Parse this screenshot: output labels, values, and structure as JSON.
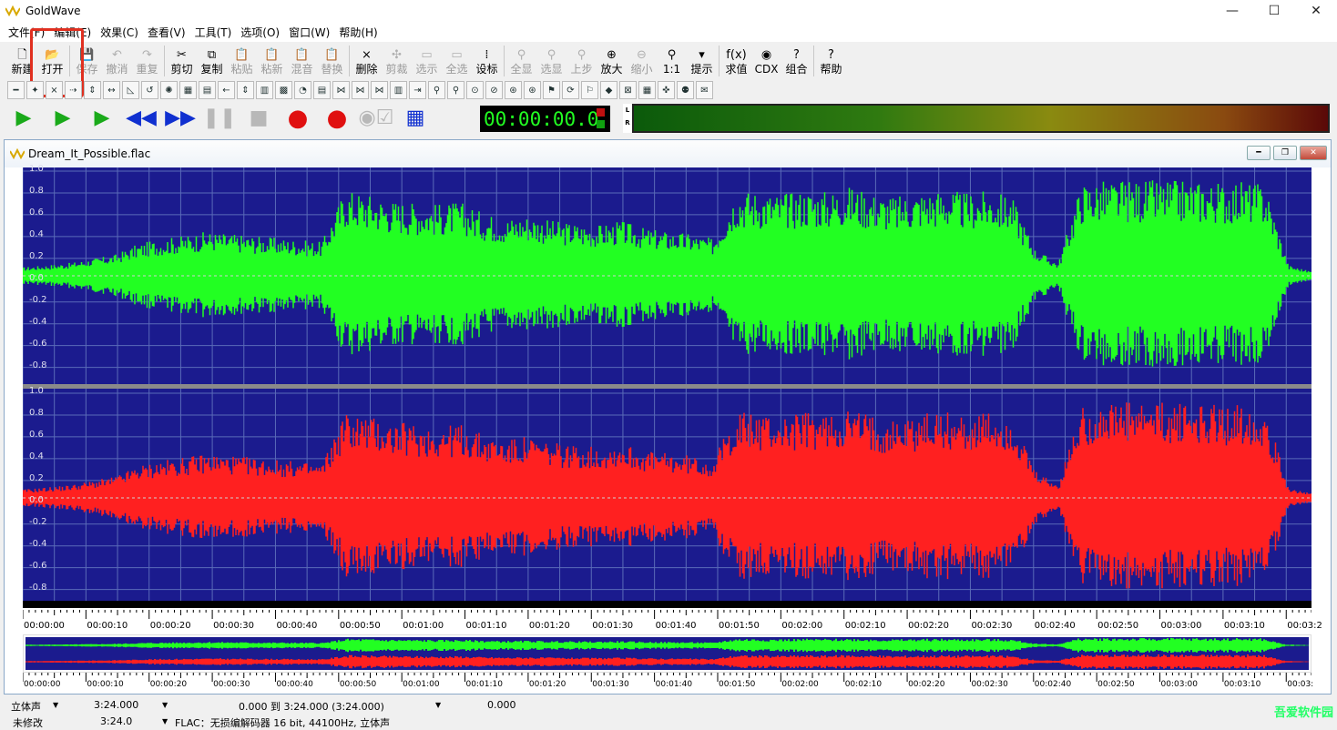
{
  "app": {
    "title": "GoldWave",
    "logo_icon": "goldwave-logo-icon"
  },
  "window_controls": {
    "minimize": "—",
    "maximize": "☐",
    "close": "✕"
  },
  "menu": [
    "文件(F)",
    "编辑(E)",
    "效果(C)",
    "查看(V)",
    "工具(T)",
    "选项(O)",
    "窗口(W)",
    "帮助(H)"
  ],
  "toolbar": [
    {
      "label": "新建",
      "icon": "new-file-icon",
      "glyph": "🗋",
      "enabled": true
    },
    {
      "label": "打开",
      "icon": "open-folder-icon",
      "glyph": "📂",
      "enabled": true
    },
    {
      "label": "保存",
      "icon": "save-icon",
      "glyph": "💾",
      "enabled": false
    },
    {
      "label": "撤消",
      "icon": "undo-icon",
      "glyph": "↶",
      "enabled": false
    },
    {
      "label": "重复",
      "icon": "redo-icon",
      "glyph": "↷",
      "enabled": false
    },
    {
      "label": "剪切",
      "icon": "cut-icon",
      "glyph": "✂",
      "enabled": true
    },
    {
      "label": "复制",
      "icon": "copy-icon",
      "glyph": "⧉",
      "enabled": true
    },
    {
      "label": "粘贴",
      "icon": "paste-icon",
      "glyph": "📋",
      "enabled": false
    },
    {
      "label": "粘新",
      "icon": "paste-new-icon",
      "glyph": "📋",
      "enabled": false
    },
    {
      "label": "混音",
      "icon": "mix-icon",
      "glyph": "📋",
      "enabled": false
    },
    {
      "label": "替换",
      "icon": "replace-icon",
      "glyph": "📋",
      "enabled": false
    },
    {
      "label": "删除",
      "icon": "delete-icon",
      "glyph": "⨯",
      "enabled": true
    },
    {
      "label": "剪裁",
      "icon": "trim-icon",
      "glyph": "✣",
      "enabled": false
    },
    {
      "label": "选示",
      "icon": "select-view-icon",
      "glyph": "▭",
      "enabled": false
    },
    {
      "label": "全选",
      "icon": "select-all-icon",
      "glyph": "▭",
      "enabled": false
    },
    {
      "label": "设标",
      "icon": "set-marker-icon",
      "glyph": "⁞",
      "enabled": true
    },
    {
      "label": "全显",
      "icon": "show-all-icon",
      "glyph": "⚲",
      "enabled": false
    },
    {
      "label": "选显",
      "icon": "show-selection-icon",
      "glyph": "⚲",
      "enabled": false
    },
    {
      "label": "上步",
      "icon": "previous-zoom-icon",
      "glyph": "⚲",
      "enabled": false
    },
    {
      "label": "放大",
      "icon": "zoom-in-icon",
      "glyph": "⊕",
      "enabled": true
    },
    {
      "label": "缩小",
      "icon": "zoom-out-icon",
      "glyph": "⊖",
      "enabled": false
    },
    {
      "label": "1:1",
      "icon": "zoom-1-1-icon",
      "glyph": "⚲",
      "enabled": true
    },
    {
      "label": "提示",
      "icon": "cue-icon",
      "glyph": "▾",
      "enabled": true
    },
    {
      "label": "求值",
      "icon": "expression-icon",
      "glyph": "f(x)",
      "enabled": true
    },
    {
      "label": "CDX",
      "icon": "cd-extract-icon",
      "glyph": "◉",
      "enabled": true
    },
    {
      "label": "组合",
      "icon": "combine-icon",
      "glyph": "?",
      "enabled": true
    },
    {
      "label": "帮助",
      "icon": "help-icon",
      "glyph": "?",
      "enabled": true
    }
  ],
  "effects_toolbar": [
    "━",
    "✦",
    "⨯",
    "⇢",
    "⇕",
    "↔",
    "◺",
    "↺",
    "✺",
    "▦",
    "▤",
    "←",
    "⇕",
    "▥",
    "▩",
    "◔",
    "▤",
    "⋈",
    "⋈",
    "⋈",
    "▥",
    "⇥",
    "⚲",
    "⚲",
    "⊙",
    "⊘",
    "⊛",
    "⊛",
    "⚑",
    "⟳",
    "⚐",
    "◆",
    "⊠",
    "▦",
    "✜",
    "⚉",
    "✉"
  ],
  "transport": [
    {
      "name": "play-button",
      "glyph": "▶",
      "cls": "g"
    },
    {
      "name": "play-selection-button",
      "glyph": "▶",
      "cls": "g"
    },
    {
      "name": "play-from-cursor-button",
      "glyph": "▶",
      "cls": "g"
    },
    {
      "name": "rewind-button",
      "glyph": "◀◀",
      "cls": "b"
    },
    {
      "name": "fast-forward-button",
      "glyph": "▶▶",
      "cls": "b"
    },
    {
      "name": "pause-button",
      "glyph": "❚❚",
      "cls": "gr"
    },
    {
      "name": "stop-button",
      "glyph": "■",
      "cls": "gr"
    },
    {
      "name": "record-button",
      "glyph": "●",
      "cls": "r"
    },
    {
      "name": "record-new-button",
      "glyph": "●",
      "cls": "r"
    },
    {
      "name": "monitor-toggle",
      "glyph": "◉☑",
      "cls": "gr"
    },
    {
      "name": "control-panel-button",
      "glyph": "▦",
      "cls": "b"
    }
  ],
  "time_display": "00:00:00.0",
  "meter": {
    "left_label": "L",
    "right_label": "R"
  },
  "document": {
    "filename": "Dream_It_Possible.flac"
  },
  "waveform": {
    "channels": [
      "left",
      "right"
    ],
    "colors": {
      "background": "#1b1b8e",
      "left": "#22ff22",
      "right": "#ff2020",
      "grid": "#5a6bb8",
      "center": "#d0d0d0"
    },
    "y_ticks": [
      "1.0",
      "0.8",
      "0.6",
      "0.4",
      "0.2",
      "0.0",
      "-0.2",
      "-0.4",
      "-0.6",
      "-0.8"
    ],
    "envelope": [
      0.08,
      0.1,
      0.12,
      0.16,
      0.2,
      0.3,
      0.35,
      0.38,
      0.42,
      0.4,
      0.38,
      0.36,
      0.34,
      0.32,
      0.82,
      0.78,
      0.72,
      0.7,
      0.68,
      0.7,
      0.6,
      0.55,
      0.58,
      0.52,
      0.5,
      0.48,
      0.52,
      0.45,
      0.42,
      0.4,
      0.35,
      0.82,
      0.8,
      0.78,
      0.82,
      0.8,
      0.85,
      0.78,
      0.75,
      0.8,
      0.82,
      0.78,
      0.8,
      0.75,
      0.25,
      0.12,
      0.88,
      0.9,
      0.9,
      0.9,
      0.9,
      0.9,
      0.88,
      0.9,
      0.86,
      0.1,
      0.04
    ],
    "duration_seconds": 204
  },
  "timeline_labels": [
    "00:00:00",
    "00:00:10",
    "00:00:20",
    "00:00:30",
    "00:00:40",
    "00:00:50",
    "00:01:00",
    "00:01:10",
    "00:01:20",
    "00:01:30",
    "00:01:40",
    "00:01:50",
    "00:02:00",
    "00:02:10",
    "00:02:20",
    "00:02:30",
    "00:02:40",
    "00:02:50",
    "00:03:00",
    "00:03:10",
    "00:03:2"
  ],
  "overview_labels": [
    "00:00:00",
    "00:00:10",
    "00:00:20",
    "00:00:30",
    "00:00:40",
    "00:00:50",
    "00:01:00",
    "00:01:10",
    "00:01:20",
    "00:01:30",
    "00:01:40",
    "00:01:50",
    "00:02:00",
    "00:02:10",
    "00:02:20",
    "00:02:30",
    "00:02:40",
    "00:02:50",
    "00:03:00",
    "00:03:10",
    "00:03:"
  ],
  "status": {
    "channel_mode": "立体声",
    "total_length": "3:24.000",
    "selection": "0.000 到 3:24.000 (3:24.000)",
    "cursor": "0.000",
    "modified": "未修改",
    "length2": "3:24.0",
    "format": "FLAC：无损编解码器 16 bit, 44100Hz, 立体声"
  },
  "watermark": {
    "text": "吾爱软件园",
    "url": "www.52zixue.com"
  }
}
